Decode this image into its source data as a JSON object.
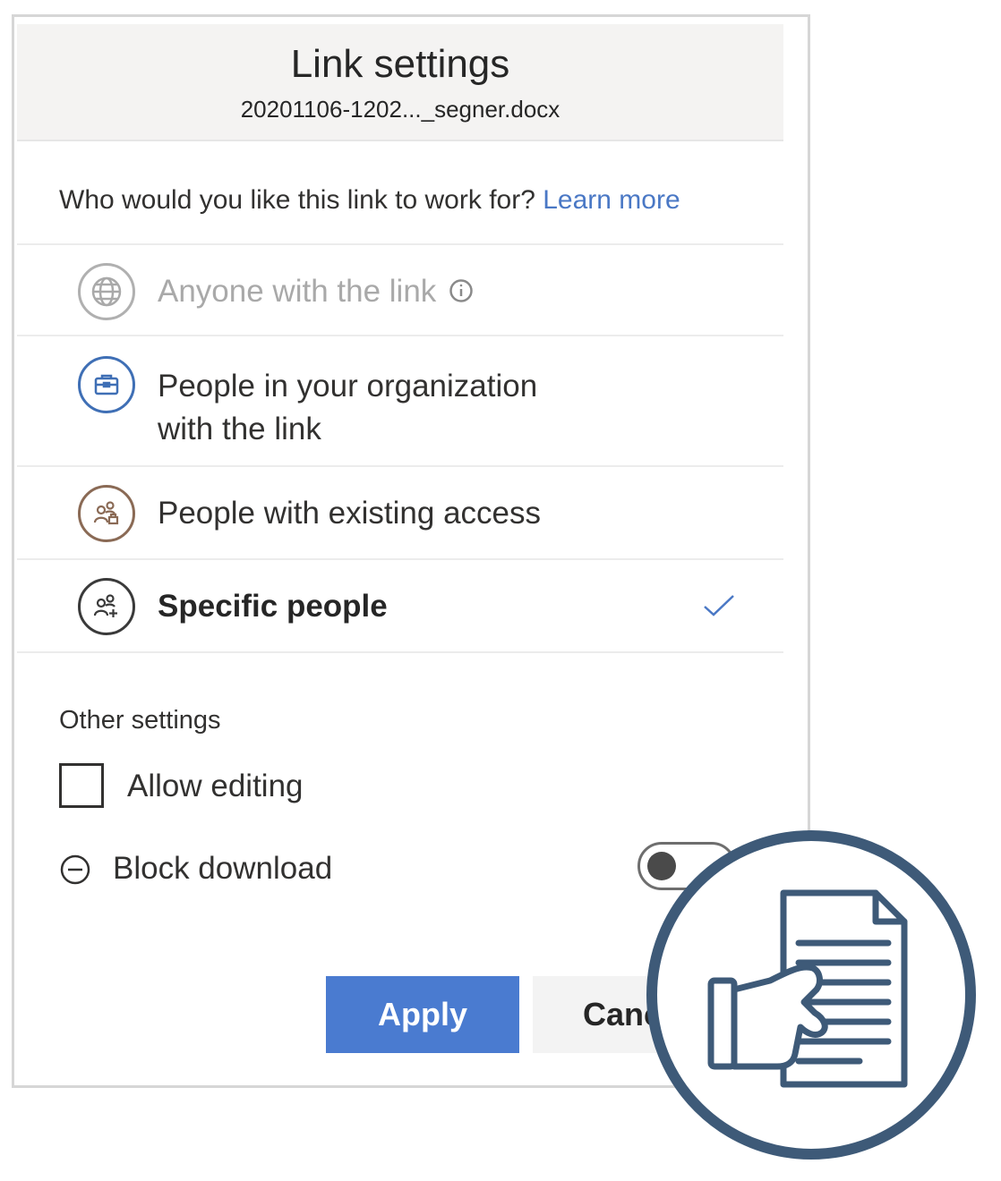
{
  "dialog": {
    "title": "Link settings",
    "filename": "20201106-1202..._segner.docx",
    "question": "Who would you like this link to work for?",
    "learn_more": "Learn more",
    "options": [
      {
        "label": "Anyone with the link",
        "icon": "globe-icon",
        "state": "disabled"
      },
      {
        "label_line1": "People in your organization",
        "label_line2": "with the link",
        "icon": "briefcase-icon",
        "color": "#3f6fb5"
      },
      {
        "label": "People with existing access",
        "icon": "people-lock-icon",
        "color": "#8a6a55"
      },
      {
        "label": "Specific people",
        "icon": "people-add-icon",
        "selected": true
      }
    ],
    "other_settings": {
      "title": "Other settings",
      "allow_editing": {
        "label": "Allow editing",
        "checked": false
      },
      "block_download": {
        "label": "Block download",
        "enabled": false
      }
    },
    "buttons": {
      "apply": "Apply",
      "cancel": "Cancel"
    }
  },
  "overlay_badge": {
    "icon": "document-hand-icon",
    "color": "#3e5a78"
  },
  "colors": {
    "accent": "#4a7bd0",
    "link": "#4a78c5"
  }
}
